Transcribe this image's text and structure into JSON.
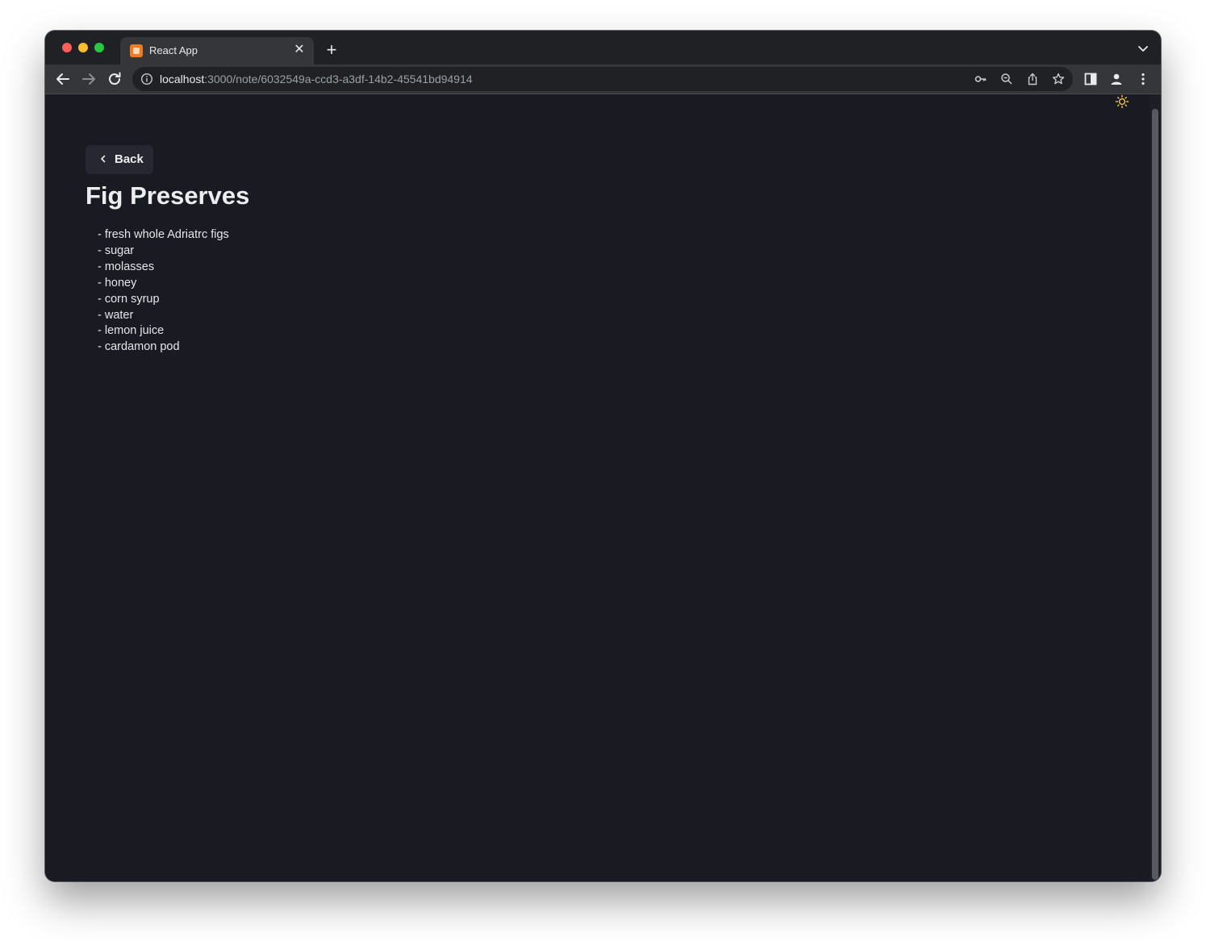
{
  "browser": {
    "tab": {
      "title": "React App"
    },
    "new_tab_symbol": "+",
    "address": {
      "host": "localhost",
      "path": ":3000/note/6032549a-ccd3-a3df-14b2-45541bd94914"
    }
  },
  "page": {
    "back_label": "Back",
    "note": {
      "title": "Fig Preserves",
      "lines": [
        "- fresh whole Adriatrc figs",
        "- sugar",
        "- molasses",
        "- honey",
        "- corn syrup",
        "- water",
        "- lemon juice",
        "- cardamon pod"
      ]
    }
  },
  "colors": {
    "page_background": "#191a22",
    "button_background": "#262730",
    "text": "#ededf0",
    "theme_icon": "#f5c451",
    "chrome_toolbar": "#35363a",
    "chrome_tabstrip": "#202124"
  },
  "icons": {
    "theme_toggle": "sun-icon",
    "back_chevron": "chevron-left-icon"
  }
}
